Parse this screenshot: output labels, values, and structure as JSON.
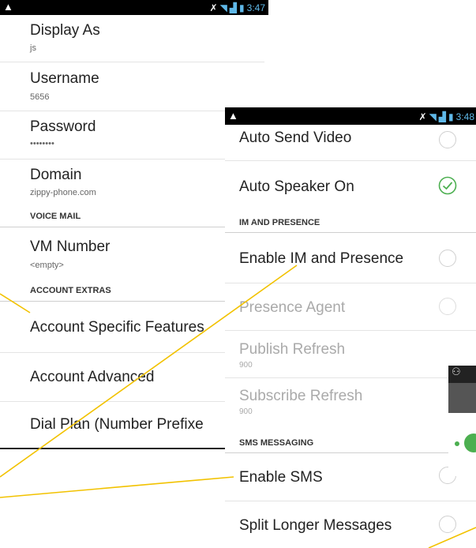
{
  "status": {
    "time_left": "3:47",
    "time_right": "3:48"
  },
  "left_screen": {
    "display_as": {
      "title": "Display As",
      "summary": "js"
    },
    "username": {
      "title": "Username",
      "summary": "5656"
    },
    "password": {
      "title": "Password",
      "summary": "••••••••"
    },
    "domain": {
      "title": "Domain",
      "summary": "zippy-phone.com"
    },
    "cat_voicemail": "VOICE MAIL",
    "vm_number": {
      "title": "VM Number",
      "summary": "<empty>"
    },
    "cat_account_extras": "ACCOUNT EXTRAS",
    "account_specific": "Account Specific Features",
    "account_advanced": "Account Advanced",
    "dial_plan": "Dial Plan (Number Prefixe"
  },
  "right_screen": {
    "auto_send_video": "Auto Send Video",
    "auto_speaker_on": "Auto Speaker On",
    "cat_im": "IM AND PRESENCE",
    "enable_im": "Enable IM and Presence",
    "presence_agent": "Presence Agent",
    "publish_refresh": {
      "title": "Publish Refresh",
      "summary": "900"
    },
    "subscribe_refresh": {
      "title": "Subscribe Refresh",
      "summary": "900"
    },
    "cat_sms": "SMS MESSAGING",
    "enable_sms": "Enable SMS",
    "split_longer": "Split Longer Messages"
  },
  "colors": {
    "accent_check": "#4caf50",
    "callout_line": "#f2c200"
  }
}
